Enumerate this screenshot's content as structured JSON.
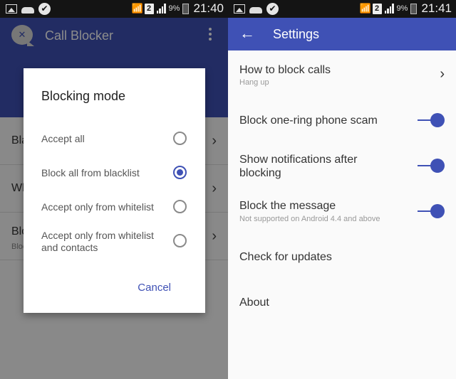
{
  "left_screen": {
    "status_bar": {
      "battery_percent": "9%",
      "sim_slot": "2",
      "time": "21:40"
    },
    "app_title": "Call Blocker",
    "list_items": [
      {
        "title": "Blacklist",
        "subtitle": ""
      },
      {
        "title": "Whitelist",
        "subtitle": ""
      },
      {
        "title": "Blocking mode",
        "subtitle": "Block all from blacklist"
      }
    ],
    "dialog": {
      "title": "Blocking mode",
      "options": [
        {
          "label": "Accept all",
          "checked": false
        },
        {
          "label": "Block all from blacklist",
          "checked": true
        },
        {
          "label": "Accept only from whitelist",
          "checked": false
        },
        {
          "label": "Accept only from whitelist and contacts",
          "checked": false
        }
      ],
      "cancel_label": "Cancel"
    }
  },
  "right_screen": {
    "status_bar": {
      "battery_percent": "9%",
      "sim_slot": "2",
      "time": "21:41"
    },
    "title": "Settings",
    "prefs": [
      {
        "title": "How to block calls",
        "subtitle": "Hang up",
        "control": "chevron"
      },
      {
        "title": "Block one-ring phone scam",
        "control": "switch",
        "on": true
      },
      {
        "title": "Show notifications after blocking",
        "control": "switch",
        "on": true
      },
      {
        "title": "Block the message",
        "subtitle": "Not supported on Android 4.4 and above",
        "control": "switch",
        "on": true
      },
      {
        "title": "Check for updates"
      },
      {
        "title": "About"
      }
    ]
  },
  "colors": {
    "primary": "#3f51b5",
    "status_bar": "#141414",
    "background": "#fafafa"
  },
  "icons": {
    "back": "←",
    "chevron": "›",
    "check": "✔",
    "wifi": "◥"
  }
}
